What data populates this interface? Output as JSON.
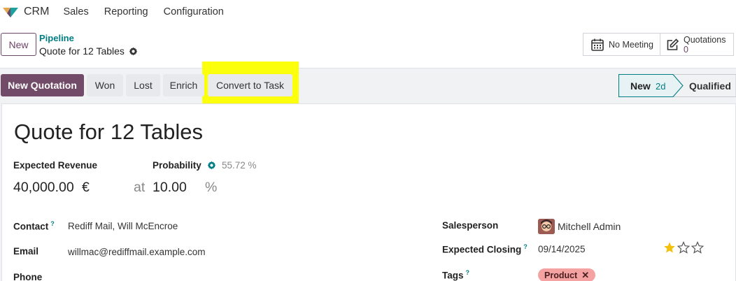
{
  "topnav": {
    "app_name": "CRM",
    "menu": [
      "Sales",
      "Reporting",
      "Configuration"
    ]
  },
  "controlpanel": {
    "new_label": "New",
    "breadcrumb_parent": "Pipeline",
    "breadcrumb_current": "Quote for 12 Tables",
    "meeting_label": "No Meeting",
    "quotations_label": "Quotations",
    "quotations_count": "0"
  },
  "statusbar": {
    "new_quotation": "New Quotation",
    "won": "Won",
    "lost": "Lost",
    "enrich": "Enrich",
    "convert_to_task": "Convert to Task",
    "stages": [
      {
        "label": "New",
        "duration": "2d",
        "active": true
      },
      {
        "label": "Qualified",
        "active": false
      }
    ]
  },
  "form": {
    "title": "Quote for 12 Tables",
    "expected_revenue_label": "Expected Revenue",
    "expected_revenue": "40,000.00",
    "currency": "€",
    "at": "at",
    "probability_label": "Probability",
    "probability_computed": "55.72 %",
    "probability": "10.00",
    "percent": "%",
    "contact_label": "Contact",
    "contact_help": "?",
    "contact": "Rediff Mail, Will McEncroe",
    "email_label": "Email",
    "email": "willmac@rediffmail.example.com",
    "phone_label": "Phone",
    "salesperson_label": "Salesperson",
    "salesperson": "Mitchell Admin",
    "expected_closing_label": "Expected Closing",
    "expected_closing_help": "?",
    "expected_closing": "09/14/2025",
    "priority_stars": 1,
    "tags_label": "Tags",
    "tags_help": "?",
    "tags": [
      "Product"
    ]
  },
  "colors": {
    "brand": "#714b67",
    "link": "#017e84",
    "highlight": "#fbff0b",
    "star": "#f3c00e",
    "tag_bg": "#f4a2a2"
  }
}
